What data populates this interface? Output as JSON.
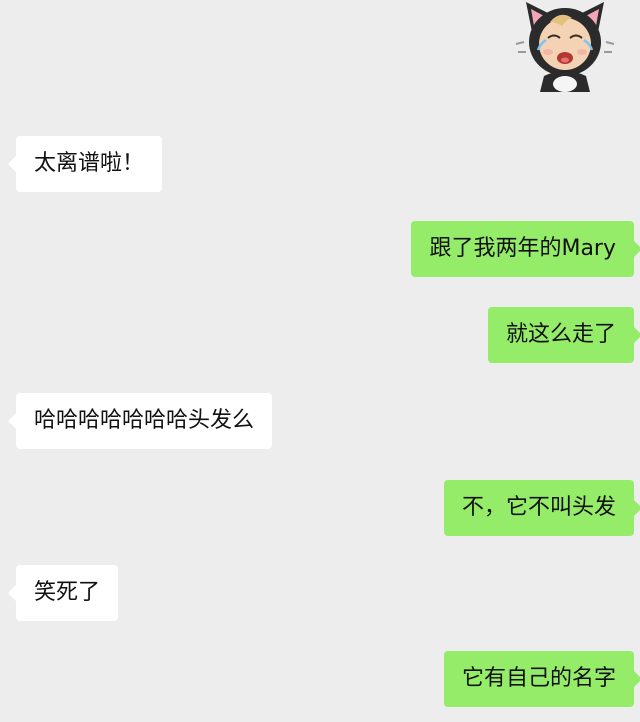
{
  "chat": {
    "sticker": {
      "icon": "crying-baby-cat-sticker-icon"
    },
    "messages": [
      {
        "direction": "incoming",
        "text": "太离谱啦！"
      },
      {
        "direction": "outgoing",
        "text": "跟了我两年的Mary"
      },
      {
        "direction": "outgoing",
        "text": "就这么走了"
      },
      {
        "direction": "incoming",
        "text": "哈哈哈哈哈哈哈头发么"
      },
      {
        "direction": "outgoing",
        "text": "不，它不叫头发"
      },
      {
        "direction": "incoming",
        "text": "笑死了"
      },
      {
        "direction": "outgoing",
        "text": "它有自己的名字"
      }
    ]
  },
  "colors": {
    "background": "#ededed",
    "incoming_bubble": "#ffffff",
    "outgoing_bubble": "#95ec69",
    "text": "#111111"
  }
}
